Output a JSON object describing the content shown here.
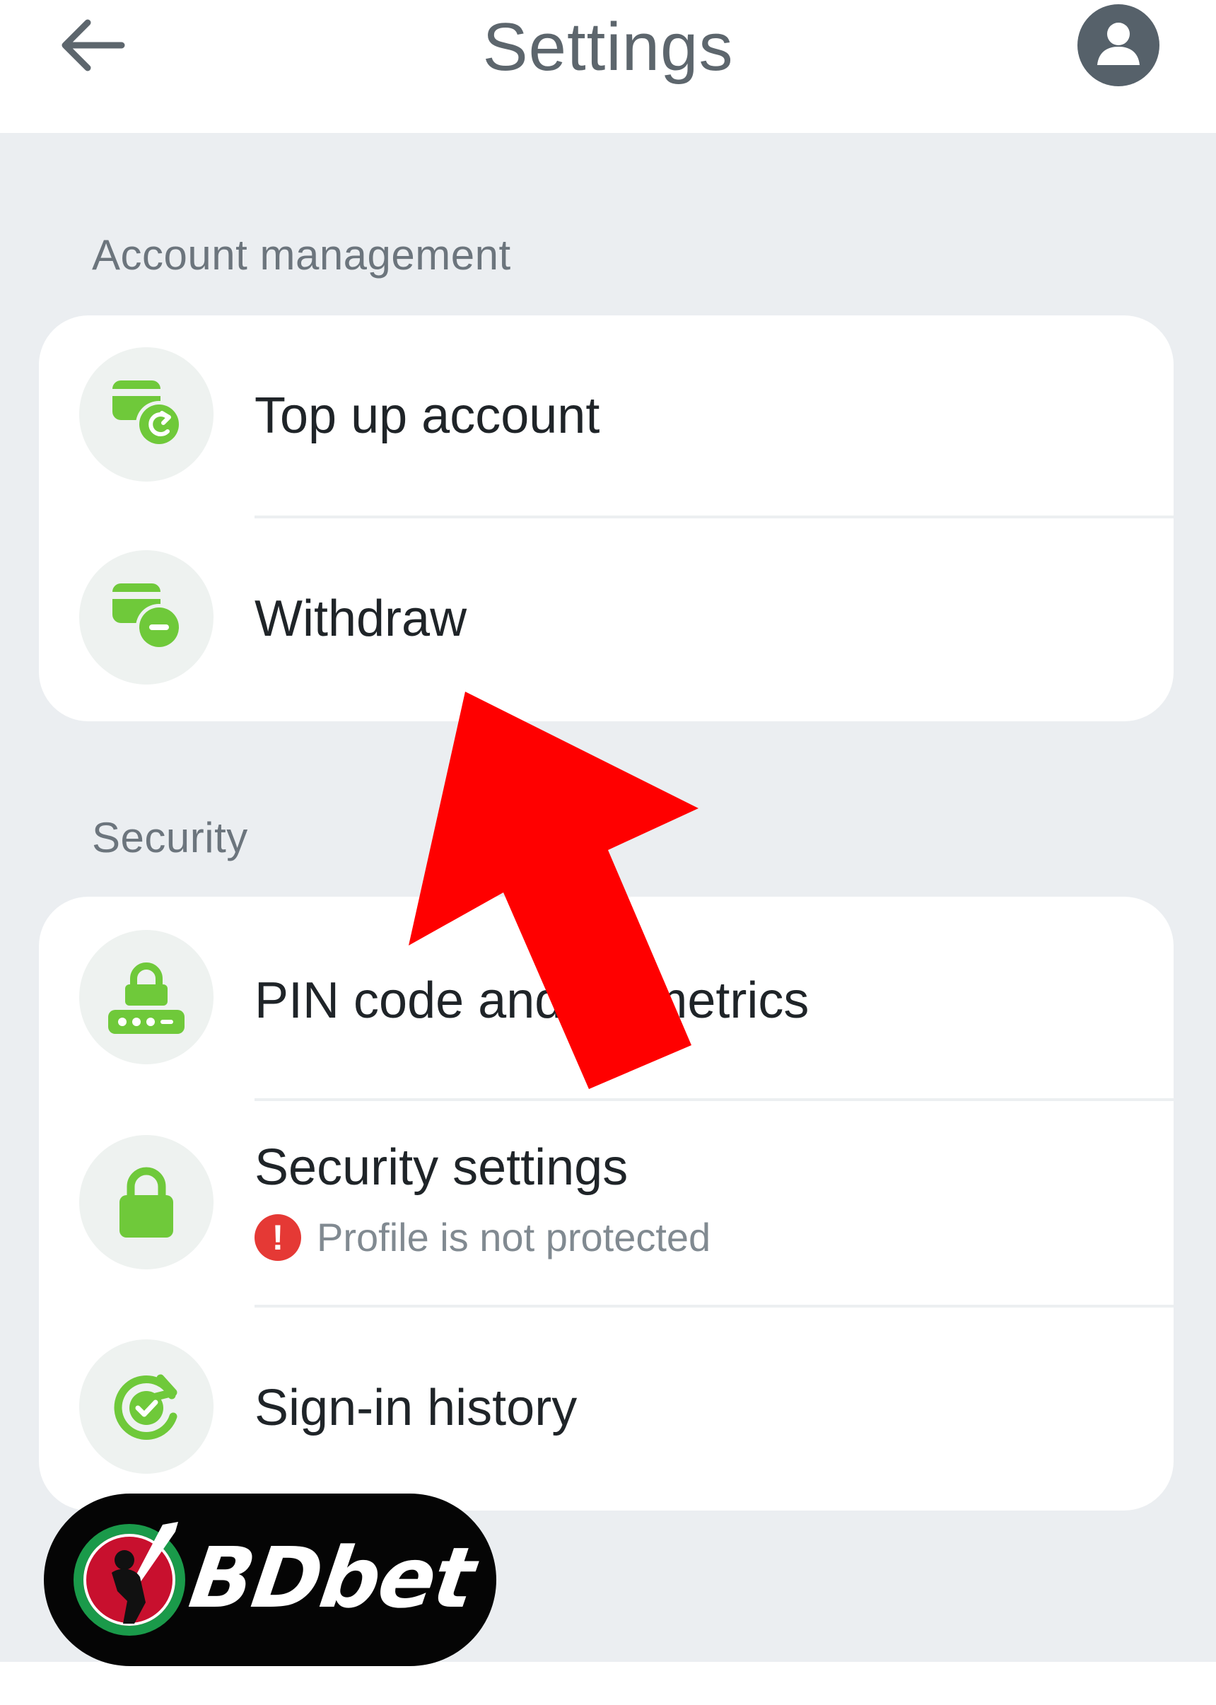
{
  "header": {
    "title": "Settings",
    "back_icon": "arrow-left-icon",
    "profile_icon": "user-icon"
  },
  "sections": [
    {
      "label": "Account management",
      "items": [
        {
          "label": "Top up account",
          "icon": "card-refresh-icon"
        },
        {
          "label": "Withdraw",
          "icon": "card-minus-icon"
        }
      ]
    },
    {
      "label": "Security",
      "items": [
        {
          "label": "PIN code and biometrics",
          "icon": "lock-pin-icon"
        },
        {
          "label": "Security settings",
          "sublabel": "Profile is not protected",
          "icon": "lock-icon",
          "warning_icon": "alert-icon"
        },
        {
          "label": "Sign-in history",
          "icon": "refresh-check-icon"
        }
      ]
    }
  ],
  "overlay": {
    "arrow_color": "#ff0000"
  },
  "watermark": {
    "brand": "BDbet"
  },
  "colors": {
    "accent_green": "#6fc93a",
    "warning_red": "#e53935",
    "background": "#ebeef1"
  }
}
